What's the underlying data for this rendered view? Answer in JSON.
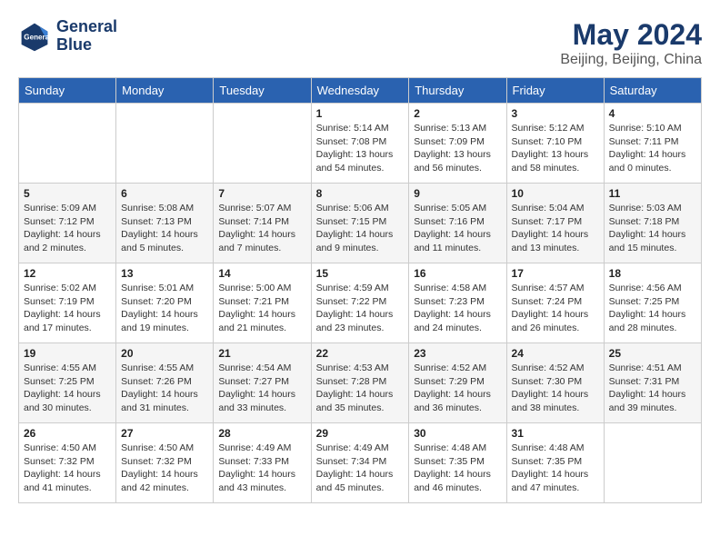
{
  "header": {
    "logo_line1": "General",
    "logo_line2": "Blue",
    "month_title": "May 2024",
    "location": "Beijing, Beijing, China"
  },
  "weekdays": [
    "Sunday",
    "Monday",
    "Tuesday",
    "Wednesday",
    "Thursday",
    "Friday",
    "Saturday"
  ],
  "weeks": [
    [
      {
        "day": "",
        "sunrise": "",
        "sunset": "",
        "daylight": ""
      },
      {
        "day": "",
        "sunrise": "",
        "sunset": "",
        "daylight": ""
      },
      {
        "day": "",
        "sunrise": "",
        "sunset": "",
        "daylight": ""
      },
      {
        "day": "1",
        "sunrise": "Sunrise: 5:14 AM",
        "sunset": "Sunset: 7:08 PM",
        "daylight": "Daylight: 13 hours and 54 minutes."
      },
      {
        "day": "2",
        "sunrise": "Sunrise: 5:13 AM",
        "sunset": "Sunset: 7:09 PM",
        "daylight": "Daylight: 13 hours and 56 minutes."
      },
      {
        "day": "3",
        "sunrise": "Sunrise: 5:12 AM",
        "sunset": "Sunset: 7:10 PM",
        "daylight": "Daylight: 13 hours and 58 minutes."
      },
      {
        "day": "4",
        "sunrise": "Sunrise: 5:10 AM",
        "sunset": "Sunset: 7:11 PM",
        "daylight": "Daylight: 14 hours and 0 minutes."
      }
    ],
    [
      {
        "day": "5",
        "sunrise": "Sunrise: 5:09 AM",
        "sunset": "Sunset: 7:12 PM",
        "daylight": "Daylight: 14 hours and 2 minutes."
      },
      {
        "day": "6",
        "sunrise": "Sunrise: 5:08 AM",
        "sunset": "Sunset: 7:13 PM",
        "daylight": "Daylight: 14 hours and 5 minutes."
      },
      {
        "day": "7",
        "sunrise": "Sunrise: 5:07 AM",
        "sunset": "Sunset: 7:14 PM",
        "daylight": "Daylight: 14 hours and 7 minutes."
      },
      {
        "day": "8",
        "sunrise": "Sunrise: 5:06 AM",
        "sunset": "Sunset: 7:15 PM",
        "daylight": "Daylight: 14 hours and 9 minutes."
      },
      {
        "day": "9",
        "sunrise": "Sunrise: 5:05 AM",
        "sunset": "Sunset: 7:16 PM",
        "daylight": "Daylight: 14 hours and 11 minutes."
      },
      {
        "day": "10",
        "sunrise": "Sunrise: 5:04 AM",
        "sunset": "Sunset: 7:17 PM",
        "daylight": "Daylight: 14 hours and 13 minutes."
      },
      {
        "day": "11",
        "sunrise": "Sunrise: 5:03 AM",
        "sunset": "Sunset: 7:18 PM",
        "daylight": "Daylight: 14 hours and 15 minutes."
      }
    ],
    [
      {
        "day": "12",
        "sunrise": "Sunrise: 5:02 AM",
        "sunset": "Sunset: 7:19 PM",
        "daylight": "Daylight: 14 hours and 17 minutes."
      },
      {
        "day": "13",
        "sunrise": "Sunrise: 5:01 AM",
        "sunset": "Sunset: 7:20 PM",
        "daylight": "Daylight: 14 hours and 19 minutes."
      },
      {
        "day": "14",
        "sunrise": "Sunrise: 5:00 AM",
        "sunset": "Sunset: 7:21 PM",
        "daylight": "Daylight: 14 hours and 21 minutes."
      },
      {
        "day": "15",
        "sunrise": "Sunrise: 4:59 AM",
        "sunset": "Sunset: 7:22 PM",
        "daylight": "Daylight: 14 hours and 23 minutes."
      },
      {
        "day": "16",
        "sunrise": "Sunrise: 4:58 AM",
        "sunset": "Sunset: 7:23 PM",
        "daylight": "Daylight: 14 hours and 24 minutes."
      },
      {
        "day": "17",
        "sunrise": "Sunrise: 4:57 AM",
        "sunset": "Sunset: 7:24 PM",
        "daylight": "Daylight: 14 hours and 26 minutes."
      },
      {
        "day": "18",
        "sunrise": "Sunrise: 4:56 AM",
        "sunset": "Sunset: 7:25 PM",
        "daylight": "Daylight: 14 hours and 28 minutes."
      }
    ],
    [
      {
        "day": "19",
        "sunrise": "Sunrise: 4:55 AM",
        "sunset": "Sunset: 7:25 PM",
        "daylight": "Daylight: 14 hours and 30 minutes."
      },
      {
        "day": "20",
        "sunrise": "Sunrise: 4:55 AM",
        "sunset": "Sunset: 7:26 PM",
        "daylight": "Daylight: 14 hours and 31 minutes."
      },
      {
        "day": "21",
        "sunrise": "Sunrise: 4:54 AM",
        "sunset": "Sunset: 7:27 PM",
        "daylight": "Daylight: 14 hours and 33 minutes."
      },
      {
        "day": "22",
        "sunrise": "Sunrise: 4:53 AM",
        "sunset": "Sunset: 7:28 PM",
        "daylight": "Daylight: 14 hours and 35 minutes."
      },
      {
        "day": "23",
        "sunrise": "Sunrise: 4:52 AM",
        "sunset": "Sunset: 7:29 PM",
        "daylight": "Daylight: 14 hours and 36 minutes."
      },
      {
        "day": "24",
        "sunrise": "Sunrise: 4:52 AM",
        "sunset": "Sunset: 7:30 PM",
        "daylight": "Daylight: 14 hours and 38 minutes."
      },
      {
        "day": "25",
        "sunrise": "Sunrise: 4:51 AM",
        "sunset": "Sunset: 7:31 PM",
        "daylight": "Daylight: 14 hours and 39 minutes."
      }
    ],
    [
      {
        "day": "26",
        "sunrise": "Sunrise: 4:50 AM",
        "sunset": "Sunset: 7:32 PM",
        "daylight": "Daylight: 14 hours and 41 minutes."
      },
      {
        "day": "27",
        "sunrise": "Sunrise: 4:50 AM",
        "sunset": "Sunset: 7:32 PM",
        "daylight": "Daylight: 14 hours and 42 minutes."
      },
      {
        "day": "28",
        "sunrise": "Sunrise: 4:49 AM",
        "sunset": "Sunset: 7:33 PM",
        "daylight": "Daylight: 14 hours and 43 minutes."
      },
      {
        "day": "29",
        "sunrise": "Sunrise: 4:49 AM",
        "sunset": "Sunset: 7:34 PM",
        "daylight": "Daylight: 14 hours and 45 minutes."
      },
      {
        "day": "30",
        "sunrise": "Sunrise: 4:48 AM",
        "sunset": "Sunset: 7:35 PM",
        "daylight": "Daylight: 14 hours and 46 minutes."
      },
      {
        "day": "31",
        "sunrise": "Sunrise: 4:48 AM",
        "sunset": "Sunset: 7:35 PM",
        "daylight": "Daylight: 14 hours and 47 minutes."
      },
      {
        "day": "",
        "sunrise": "",
        "sunset": "",
        "daylight": ""
      }
    ]
  ]
}
